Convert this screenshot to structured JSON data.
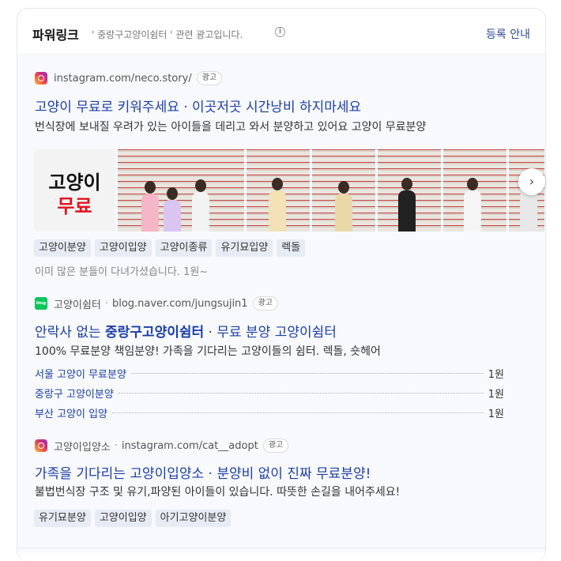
{
  "header": {
    "title": "파워링크",
    "description": "' 중랑구고양이쉼터 ' 관련 광고입니다.",
    "info_icon": "info-icon",
    "register_link": "등록 안내"
  },
  "ads": [
    {
      "source_icon": "instagram-icon",
      "source_name": "",
      "url": "instagram.com/neco.story/",
      "badge": "광고",
      "title": "고양이 무료로 키워주세요 · 이곳저곳 시간낭비 하지마세요",
      "description": "번식장에 보내질 우려가 있는 아이들을 데리고 와서 분양하고 있어요 고양이 무료분양",
      "thumbnail_text_line1": "고양이",
      "thumbnail_text_line2": "무료",
      "tags": [
        "고양이분양",
        "고양이입양",
        "고양이종류",
        "유기묘입양",
        "렉돌"
      ],
      "note": "이미 많은 분들이 다녀가셨습니다. 1원~"
    },
    {
      "source_icon": "naver-blog-icon",
      "source_name": "고양이쉼터",
      "url": "blog.naver.com/jungsujin1",
      "badge": "광고",
      "title_prefix": "안락사 없는 ",
      "title_bold": "중랑구고양이쉼터",
      "title_suffix": " · 무료 분양 고양이쉼터",
      "description": "100% 무료분양 책임분양! 가족을 기다리는 고양이들의 쉼터. 렉돌, 숏헤어",
      "sublinks": [
        {
          "label": "서울 고양이 무료분양",
          "value": "1원"
        },
        {
          "label": "중랑구 고양이분양",
          "value": "1원"
        },
        {
          "label": "부산 고양이 입양",
          "value": "1원"
        }
      ]
    },
    {
      "source_icon": "instagram-icon",
      "source_name": "고양이입양소",
      "url": "instagram.com/cat__adopt",
      "badge": "광고",
      "title": "가족을 기다리는 고양이입양소 · 분양비 없이 진짜 무료분양!",
      "description": "불법번식장 구조 및 유기,파양된 아이들이 있습니다. 따뜻한 손길을 내어주세요!",
      "tags": [
        "유기묘분양",
        "고양이입양",
        "아기고양이분양"
      ]
    }
  ],
  "blog_icon_text": "blog",
  "next_arrow": "›",
  "info_glyph": "i"
}
